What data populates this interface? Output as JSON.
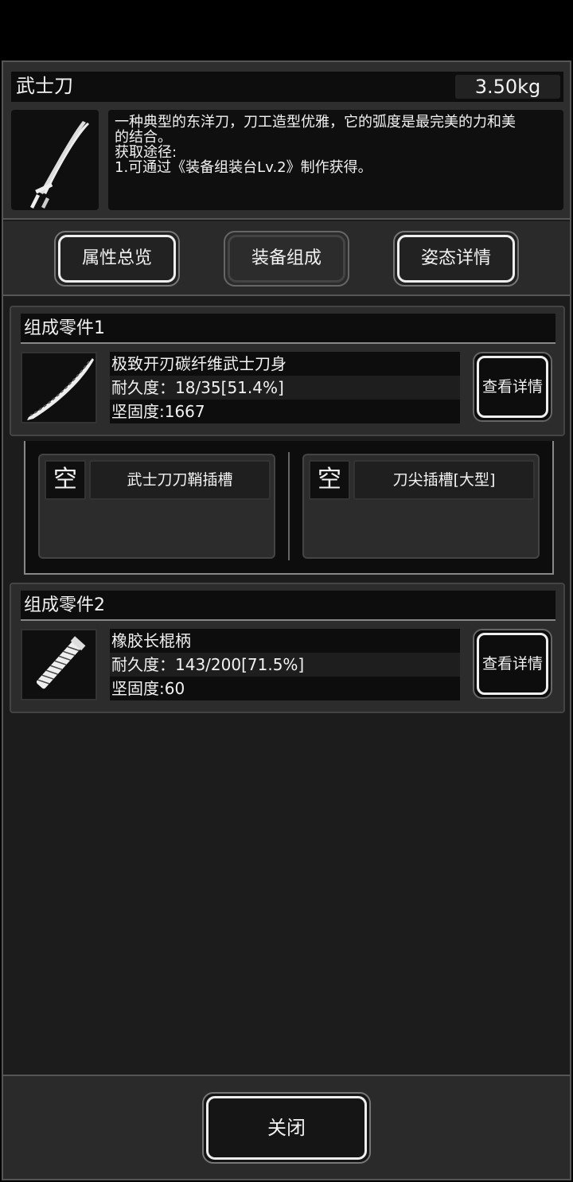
{
  "item": {
    "name": "武士刀",
    "weight": "3.50kg",
    "icon": "katana-icon",
    "description_lines": [
      "一种典型的东洋刀，刀工造型优雅，它的弧度是最完美的力和美",
      "的结合。",
      "获取途径:",
      "1.可通过《装备组装台Lv.2》制作获得。"
    ]
  },
  "tabs": [
    {
      "label": "属性总览"
    },
    {
      "label": "装备组成",
      "active": true
    },
    {
      "label": "姿态详情"
    }
  ],
  "parts": [
    {
      "header": "组成零件1",
      "icon": "blade-icon",
      "name": "极致开刃碳纤维武士刀身",
      "durability": "耐久度：18/35[51.4%]",
      "firmness": "坚固度:1667",
      "detail_label": "查看详情",
      "slots": [
        {
          "status": "空",
          "name": "武士刀刀鞘插槽"
        },
        {
          "status": "空",
          "name": "刀尖插槽[大型]"
        }
      ]
    },
    {
      "header": "组成零件2",
      "icon": "handle-icon",
      "name": "橡胶长棍柄",
      "durability": "耐久度：143/200[71.5%]",
      "firmness": "坚固度:60",
      "detail_label": "查看详情"
    }
  ],
  "footer": {
    "close_label": "关闭"
  }
}
